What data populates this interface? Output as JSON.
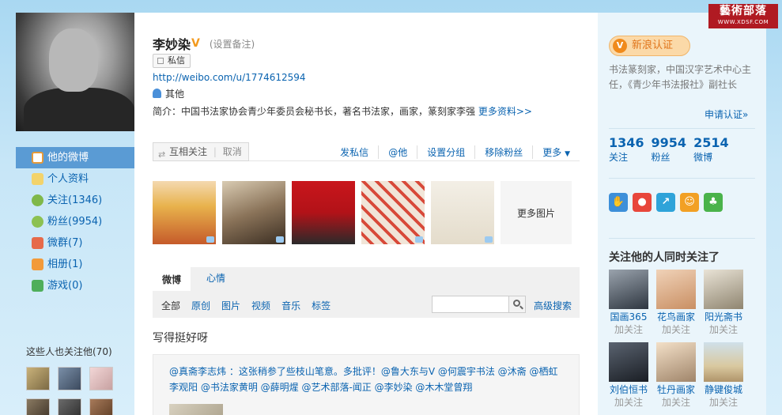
{
  "profile": {
    "name": "李妙染",
    "verified_mark": "V",
    "remark_link": "(设置备注)",
    "message_button": "私信",
    "url": "http://weibo.com/u/1774612594",
    "location": "其他",
    "intro": "简介：中国书法家协会青少年委员会秘书长，著名书法家，画家，篆刻家李强",
    "more_info": "更多资料>>"
  },
  "nav": {
    "items": [
      {
        "label": "他的微博",
        "icon": "home-icon",
        "active": true
      },
      {
        "label": "个人资料",
        "icon": "profile-icon"
      },
      {
        "label": "关注(1346)",
        "icon": "follow-icon"
      },
      {
        "label": "粉丝(9954)",
        "icon": "fans-icon"
      },
      {
        "label": "微群(7)",
        "icon": "group-icon"
      },
      {
        "label": "相册(1)",
        "icon": "album-icon"
      },
      {
        "label": "游戏(0)",
        "icon": "game-icon"
      }
    ],
    "also_follow_title": "这些人也关注他(70)"
  },
  "actions": {
    "mutual": "互相关注",
    "cancel": "取消",
    "send_message": "发私信",
    "at_him": "@他",
    "set_group": "设置分组",
    "remove_fan": "移除粉丝",
    "more": "更多"
  },
  "photos": {
    "more": "更多图片"
  },
  "tabs": {
    "weibo": "微博",
    "mood": "心情"
  },
  "filters": {
    "items": [
      "全部",
      "原创",
      "图片",
      "视频",
      "音乐",
      "标签"
    ],
    "search_value": "",
    "advanced_search": "高级搜索"
  },
  "post": {
    "text": "写得挺好呀",
    "repost_line1": "@真斋李志炜 ：这张稍参了些枝山笔意。多批评！@鲁大东与V @何震宇书法 @沐斋 @栖虹",
    "repost_line2": "李观阳 @书法家黄明 @薛明煋 @艺术部落-闻正 @李妙染 @木木堂曾翔"
  },
  "sidebar": {
    "verify_label": "新浪认证",
    "verify_desc": "书法篆刻家，中国汉字艺术中心主任，《青少年书法报社》副社长",
    "apply": "申请认证»",
    "stats": [
      {
        "num": "1346",
        "label": "关注"
      },
      {
        "num": "9954",
        "label": "粉丝"
      },
      {
        "num": "2514",
        "label": "微博"
      }
    ],
    "follows_title": "关注他的人同时关注了",
    "follows": [
      {
        "name": "国画365",
        "follow": "加关注"
      },
      {
        "name": "花鸟画家",
        "follow": "加关注"
      },
      {
        "name": "阳光斋书",
        "follow": "加关注"
      },
      {
        "name": "刘伯恒书",
        "follow": "加关注"
      },
      {
        "name": "牡丹画家",
        "follow": "加关注"
      },
      {
        "name": "静键俊城",
        "follow": "加关注"
      }
    ]
  },
  "watermark": {
    "line1": "藝術部落",
    "line2": "WWW.XDSF.COM"
  }
}
